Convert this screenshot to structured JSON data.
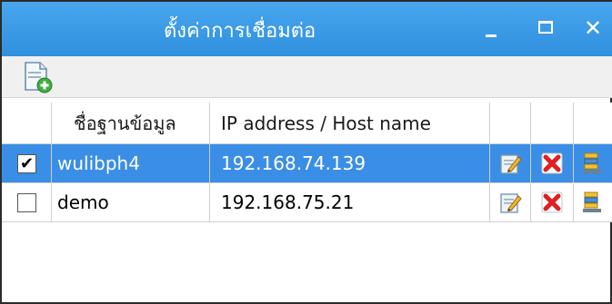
{
  "window": {
    "title": "ตั้งค่าการเชื่อมต่อ",
    "minimize_glyph": "_",
    "close_glyph": "✕"
  },
  "toolbar": {
    "new_icon": "new-document-icon"
  },
  "table": {
    "columns": [
      "",
      "ชื่อฐานข้อมูล",
      "IP address / Host name",
      "",
      "",
      ""
    ],
    "rows": [
      {
        "checked": true,
        "check_glyph": "✔",
        "name": "wulibph4",
        "ip": "192.168.74.139",
        "selected": true
      },
      {
        "checked": false,
        "check_glyph": "",
        "name": "demo",
        "ip": "192.168.75.21",
        "selected": false
      }
    ],
    "row_icons": [
      "edit-icon",
      "delete-icon",
      "database-icon"
    ]
  },
  "colors": {
    "titlebar": "#3b9ae8",
    "selected_row": "#3a8ee6",
    "delete_red": "#e02020"
  }
}
